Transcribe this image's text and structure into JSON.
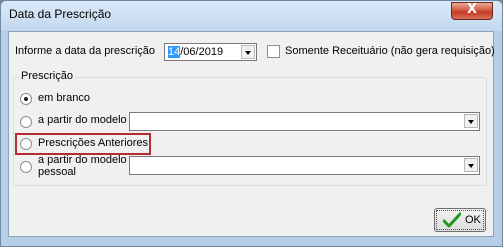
{
  "window": {
    "title": "Data da Prescrição",
    "close_glyph": "X"
  },
  "form": {
    "date_label": "Informe a data da prescrição",
    "date_value_selected": "14",
    "date_value_rest": "/06/2019",
    "checkbox_label": "Somente Receituário (não gera requisição)"
  },
  "group": {
    "legend": "Prescrição",
    "options": [
      {
        "label": "em branco",
        "checked": true
      },
      {
        "label": "a partir do modelo",
        "checked": false
      },
      {
        "label": "Prescrições Anteriores",
        "checked": false
      },
      {
        "label_line1": "a partir do modelo",
        "label_line2": "pessoal",
        "checked": false
      }
    ]
  },
  "buttons": {
    "ok_label": "OK"
  },
  "colors": {
    "highlight": "#b22d38",
    "ok_check": "#1e9a1e",
    "selection": "#3399ff"
  }
}
